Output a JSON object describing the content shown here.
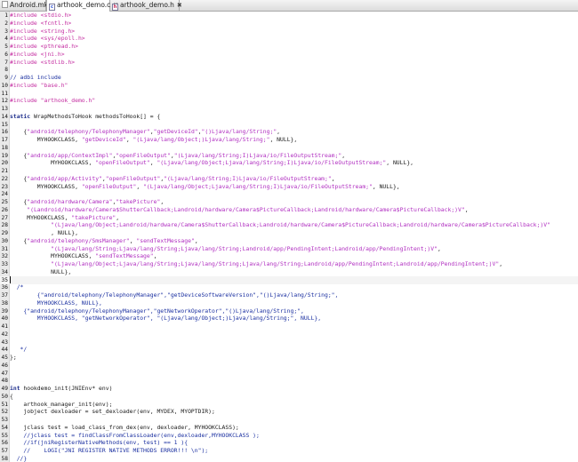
{
  "tabs": [
    {
      "label": "Android.mk",
      "icon": "plain",
      "active": false
    },
    {
      "label": "arthook_demo.c",
      "icon": "c",
      "active": true
    },
    {
      "label": "arthook_demo.h",
      "icon": "h",
      "active": false
    }
  ],
  "lines": [
    {
      "n": "1",
      "t": [
        [
          "pp",
          "#include <stdio.h>"
        ]
      ]
    },
    {
      "n": "2",
      "t": [
        [
          "pp",
          "#include <fcntl.h>"
        ]
      ]
    },
    {
      "n": "3",
      "t": [
        [
          "pp",
          "#include <string.h>"
        ]
      ]
    },
    {
      "n": "4",
      "t": [
        [
          "pp",
          "#include <sys/epoll.h>"
        ]
      ]
    },
    {
      "n": "5",
      "t": [
        [
          "pp",
          "#include <pthread.h>"
        ]
      ]
    },
    {
      "n": "6",
      "t": [
        [
          "pp",
          "#include <jni.h>"
        ]
      ]
    },
    {
      "n": "7",
      "t": [
        [
          "pp",
          "#include <stdlib.h>"
        ]
      ]
    },
    {
      "n": "8",
      "t": []
    },
    {
      "n": "9",
      "t": [
        [
          "com",
          "// adbi include"
        ]
      ]
    },
    {
      "n": "10",
      "t": [
        [
          "pp",
          "#include \"base.h\""
        ]
      ]
    },
    {
      "n": "11",
      "t": []
    },
    {
      "n": "12",
      "t": [
        [
          "pp",
          "#include \"arthook_demo.h\""
        ]
      ]
    },
    {
      "n": "13",
      "t": []
    },
    {
      "n": "14",
      "t": [
        [
          "kw",
          "static"
        ],
        [
          "def",
          " WrapMethodsToHook methodsToHook[] = {"
        ]
      ]
    },
    {
      "n": "15",
      "t": []
    },
    {
      "n": "16",
      "t": [
        [
          "def",
          "    {"
        ],
        [
          "str",
          "\"android/telephony/TelephonyManager\""
        ],
        [
          "def",
          ","
        ],
        [
          "str",
          "\"getDeviceId\""
        ],
        [
          "def",
          ","
        ],
        [
          "str",
          "\"()Ljava/lang/String;\""
        ],
        [
          "def",
          ","
        ]
      ]
    },
    {
      "n": "17",
      "t": [
        [
          "def",
          "        MYHOOKCLASS, "
        ],
        [
          "str",
          "\"getDeviceId\""
        ],
        [
          "def",
          ", "
        ],
        [
          "str",
          "\"(Ljava/lang/Object;)Ljava/lang/String;\""
        ],
        [
          "def",
          ", NULL},"
        ]
      ]
    },
    {
      "n": "18",
      "t": []
    },
    {
      "n": "19",
      "t": [
        [
          "def",
          "    {"
        ],
        [
          "str",
          "\"android/app/ContextImpl\""
        ],
        [
          "def",
          ","
        ],
        [
          "str",
          "\"openFileOutput\""
        ],
        [
          "def",
          ","
        ],
        [
          "str",
          "\"(Ljava/lang/String;I)Ljava/io/FileOutputStream;\""
        ],
        [
          "def",
          ","
        ]
      ]
    },
    {
      "n": "20",
      "t": [
        [
          "def",
          "            MYHOOKCLASS, "
        ],
        [
          "str",
          "\"openFileOutput\""
        ],
        [
          "def",
          ", "
        ],
        [
          "str",
          "\"(Ljava/lang/Object;Ljava/lang/String;I)Ljava/io/FileOutputStream;\""
        ],
        [
          "def",
          ", NULL},"
        ]
      ]
    },
    {
      "n": "21",
      "t": []
    },
    {
      "n": "22",
      "t": [
        [
          "def",
          "    {"
        ],
        [
          "str",
          "\"android/app/Activity\""
        ],
        [
          "def",
          ","
        ],
        [
          "str",
          "\"openFileOutput\""
        ],
        [
          "def",
          ","
        ],
        [
          "str",
          "\"(Ljava/lang/String;I)Ljava/io/FileOutputStream;\""
        ],
        [
          "def",
          ","
        ]
      ]
    },
    {
      "n": "23",
      "t": [
        [
          "def",
          "        MYHOOKCLASS, "
        ],
        [
          "str",
          "\"openFileOutput\""
        ],
        [
          "def",
          ", "
        ],
        [
          "str",
          "\"(Ljava/lang/Object;Ljava/lang/String;I)Ljava/io/FileOutputStream;\""
        ],
        [
          "def",
          ", NULL},"
        ]
      ]
    },
    {
      "n": "24",
      "t": []
    },
    {
      "n": "25",
      "t": [
        [
          "def",
          "    {"
        ],
        [
          "str",
          "\"android/hardware/Camera\""
        ],
        [
          "def",
          ","
        ],
        [
          "str",
          "\"takePicture\""
        ],
        [
          "def",
          ","
        ]
      ]
    },
    {
      "n": "26",
      "t": [
        [
          "def",
          "     "
        ],
        [
          "str",
          "\"(Landroid/hardware/Camera$ShutterCallback;Landroid/hardware/Camera$PictureCallback;Landroid/hardware/Camera$PictureCallback;)V\""
        ],
        [
          "def",
          ","
        ]
      ]
    },
    {
      "n": "27",
      "t": [
        [
          "def",
          "     MYHOOKCLASS, "
        ],
        [
          "str",
          "\"takePicture\""
        ],
        [
          "def",
          ","
        ]
      ]
    },
    {
      "n": "28",
      "t": [
        [
          "def",
          "            "
        ],
        [
          "str",
          "\"(Ljava/lang/Object;Landroid/hardware/Camera$ShutterCallback;Landroid/hardware/Camera$PictureCallback;Landroid/hardware/Camera$PictureCallback;)V\""
        ]
      ]
    },
    {
      "n": "29",
      "t": [
        [
          "def",
          "            , NULL},"
        ]
      ]
    },
    {
      "n": "30",
      "t": [
        [
          "def",
          "    {"
        ],
        [
          "str",
          "\"android/telephony/SmsManager\""
        ],
        [
          "def",
          ", "
        ],
        [
          "str",
          "\"sendTextMessage\""
        ],
        [
          "def",
          ","
        ]
      ]
    },
    {
      "n": "31",
      "t": [
        [
          "def",
          "            "
        ],
        [
          "str",
          "\"(Ljava/lang/String;Ljava/lang/String;Ljava/lang/String;Landroid/app/PendingIntent;Landroid/app/PendingIntent;)V\""
        ],
        [
          "def",
          ","
        ]
      ]
    },
    {
      "n": "32",
      "t": [
        [
          "def",
          "            MYHOOKCLASS, "
        ],
        [
          "str",
          "\"sendTextMessage\""
        ],
        [
          "def",
          ","
        ]
      ]
    },
    {
      "n": "33",
      "t": [
        [
          "def",
          "            "
        ],
        [
          "str",
          "\"(Ljava/lang/Object;Ljava/lang/String;Ljava/lang/String;Ljava/lang/String;Landroid/app/PendingIntent;Landroid/app/PendingIntent;)V\""
        ],
        [
          "def",
          ","
        ]
      ]
    },
    {
      "n": "34",
      "t": [
        [
          "def",
          "            NULL},"
        ]
      ]
    },
    {
      "n": "35",
      "t": [],
      "cursor": true
    },
    {
      "n": "36",
      "t": [
        [
          "com",
          "  /*"
        ]
      ]
    },
    {
      "n": "37",
      "t": [
        [
          "com",
          "        {\"android/telephony/TelephonyManager\",\"getDeviceSoftwareVersion\",\"()Ljava/lang/String;\","
        ]
      ]
    },
    {
      "n": "38",
      "t": [
        [
          "com",
          "        MYHOOKCLASS, NULL},"
        ]
      ]
    },
    {
      "n": "39",
      "t": [
        [
          "com",
          "    {\"android/telephony/TelephonyManager\",\"getNetworkOperator\",\"()Ljava/lang/String;\","
        ]
      ]
    },
    {
      "n": "40",
      "t": [
        [
          "com",
          "        MYHOOKCLASS, \"getNetworkOperator\", \"(Ljava/lang/Object;)Ljava/lang/String;\", NULL},"
        ]
      ]
    },
    {
      "n": "41",
      "t": []
    },
    {
      "n": "42",
      "t": []
    },
    {
      "n": "43",
      "t": []
    },
    {
      "n": "44",
      "t": [
        [
          "com",
          "   */"
        ]
      ]
    },
    {
      "n": "45",
      "t": [
        [
          "def",
          "};"
        ]
      ]
    },
    {
      "n": "46",
      "t": []
    },
    {
      "n": "47",
      "t": []
    },
    {
      "n": "48",
      "t": []
    },
    {
      "n": "49",
      "t": [
        [
          "kw",
          "int"
        ],
        [
          "def",
          " hookdemo_init(JNIEnv* env)"
        ]
      ]
    },
    {
      "n": "50",
      "t": [
        [
          "def",
          "{"
        ]
      ]
    },
    {
      "n": "51",
      "t": [
        [
          "def",
          "    arthook_manager_init(env);"
        ]
      ]
    },
    {
      "n": "52",
      "t": [
        [
          "def",
          "    jobject dexloader = set_dexloader(env, MYDEX, MYOPTDIR);"
        ]
      ]
    },
    {
      "n": "53",
      "t": []
    },
    {
      "n": "54",
      "t": [
        [
          "def",
          "    jclass test = load_class_from_dex(env, dexloader, MYHOOKCLASS);"
        ]
      ]
    },
    {
      "n": "55",
      "t": [
        [
          "com",
          "    //jclass test = findClassFromClassLoader(env,dexloader,MYHOOKCLASS );"
        ]
      ]
    },
    {
      "n": "56",
      "t": [
        [
          "com",
          "    //if(jniRegisterNativeMethods(env, test) == 1 ){"
        ]
      ]
    },
    {
      "n": "57",
      "t": [
        [
          "com",
          "    //    LOGI(\"JNI REGISTER NATIVE METHODS ERROR!!! \\n\");"
        ]
      ]
    },
    {
      "n": "58",
      "t": [
        [
          "com",
          "  //}"
        ]
      ]
    }
  ]
}
